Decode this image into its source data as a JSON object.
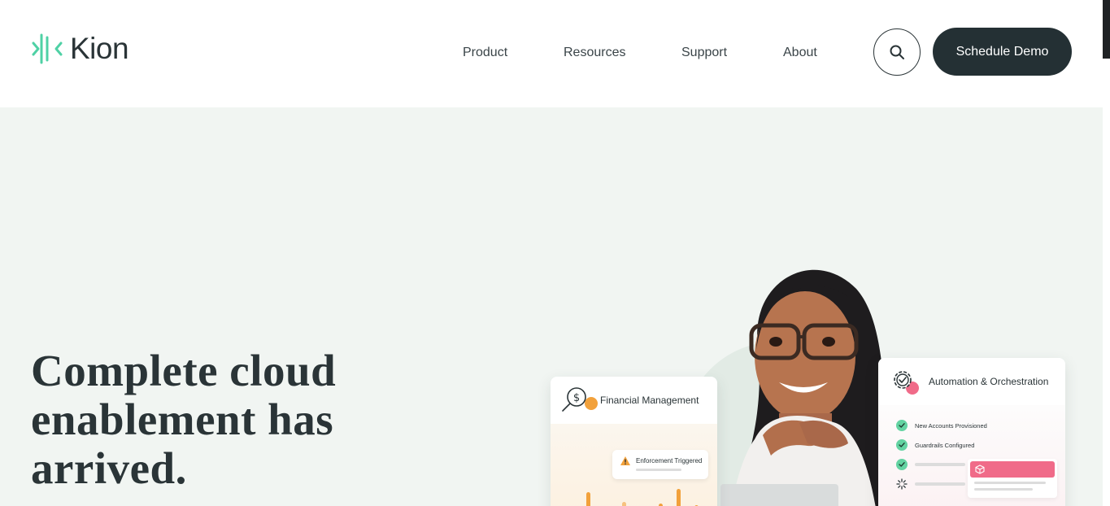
{
  "brand": {
    "name": "Kion",
    "accent": "#4fd1a5"
  },
  "nav": {
    "items": [
      {
        "label": "Product"
      },
      {
        "label": "Resources"
      },
      {
        "label": "Support"
      },
      {
        "label": "About"
      }
    ],
    "search_icon": "search-icon",
    "cta_label": "Schedule Demo"
  },
  "hero": {
    "title_lines": [
      "Complete cloud",
      "enablement has",
      "arrived."
    ]
  },
  "cards": {
    "financial": {
      "title": "Financial Management",
      "icon": "dollar-magnifier-icon",
      "alert_label": "Enforcement Triggered",
      "alert_icon": "warning-icon"
    },
    "automation": {
      "title": "Automation & Orchestration",
      "icon": "gear-check-icon",
      "items": [
        {
          "label": "New Accounts Provisioned",
          "status": "done"
        },
        {
          "label": "Guardrails Configured",
          "status": "done"
        },
        {
          "label": "",
          "status": "done"
        },
        {
          "label": "",
          "status": "loading"
        }
      ]
    }
  },
  "colors": {
    "dark": "#243034",
    "hero_bg": "#f1f5f2",
    "check_green": "#63d3a2",
    "bar_orange": "#f2a13b",
    "pink": "#f06b89"
  }
}
